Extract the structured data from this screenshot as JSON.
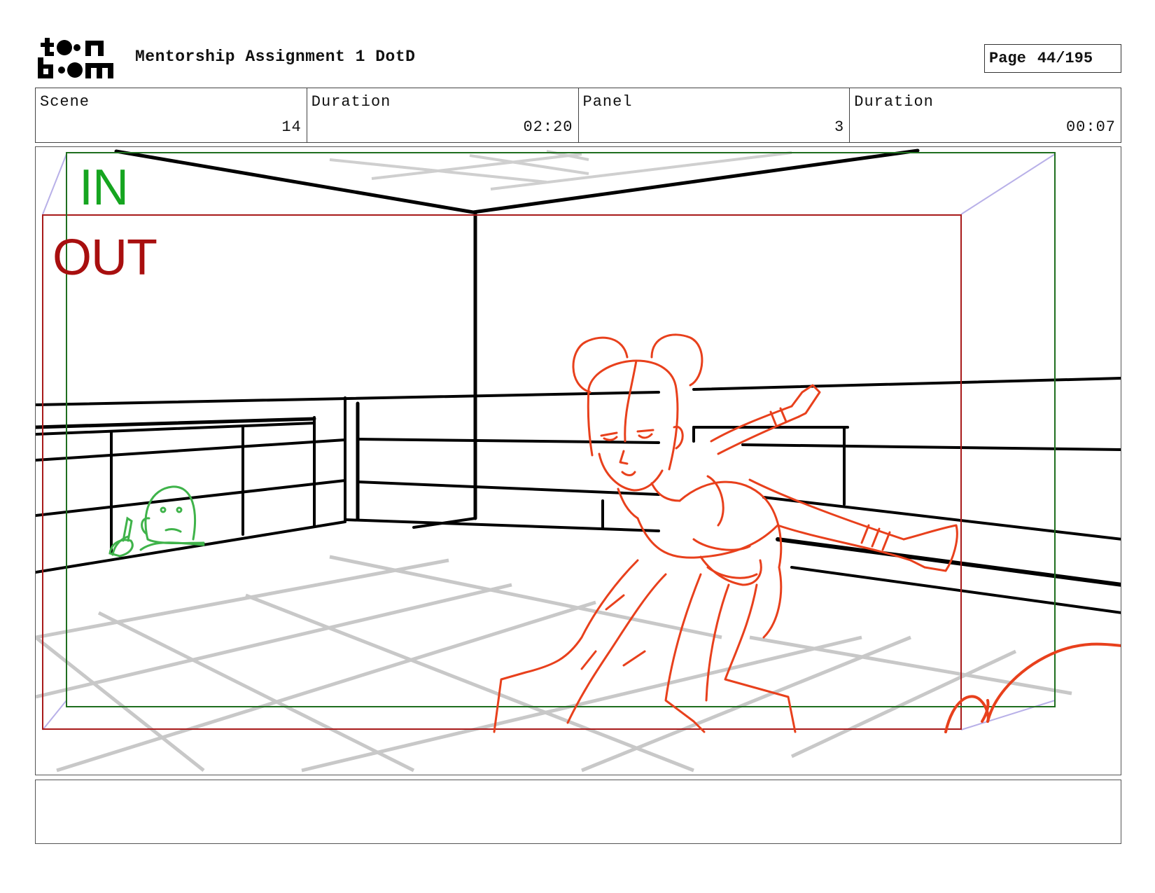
{
  "header": {
    "logo_text": "toon boom",
    "title": "Mentorship Assignment 1 DotD",
    "page_label": "Page",
    "page_number": "44/195"
  },
  "info": {
    "scene_label": "Scene",
    "scene_value": "14",
    "scene_duration_label": "Duration",
    "scene_duration_value": "02:20",
    "panel_label": "Panel",
    "panel_value": "3",
    "panel_duration_label": "Duration",
    "panel_duration_value": "00:07"
  },
  "panel": {
    "in_label": "IN",
    "out_label": "OUT",
    "colors": {
      "in_frame": "#1f6e1f",
      "out_frame": "#a81a1a",
      "character": "#e8401c",
      "bystander": "#3fb34a",
      "floor_grid": "#c8c8c8"
    }
  },
  "notes": {
    "text": ""
  }
}
